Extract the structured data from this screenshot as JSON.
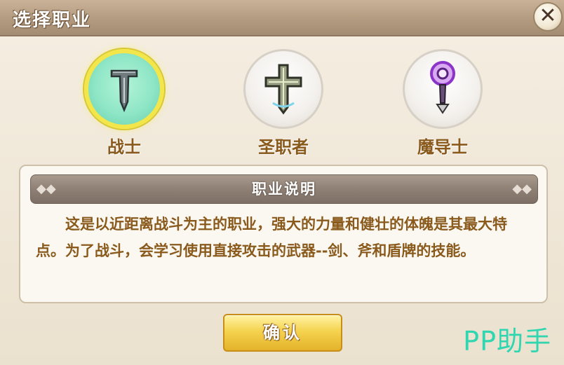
{
  "window": {
    "title": "选择职业",
    "close_icon": "close-icon"
  },
  "classes": [
    {
      "name": "战士",
      "icon": "sword-icon",
      "selected": true
    },
    {
      "name": "圣职者",
      "icon": "holy-cross-icon",
      "selected": false
    },
    {
      "name": "魔导士",
      "icon": "magic-staff-icon",
      "selected": false
    }
  ],
  "description": {
    "header": "职业说明",
    "text": "这是以近距离战斗为主的职业，强大的力量和健壮的体魄是其最大特点。为了战斗，会学习使用直接攻击的武器--剑、斧和盾牌的技能。"
  },
  "confirm_label": "确认",
  "watermark": "PP助手",
  "colors": {
    "accent_text": "#8a5a1c",
    "selected_ring": "#f3e64a",
    "watermark": "#2fd6b0"
  }
}
